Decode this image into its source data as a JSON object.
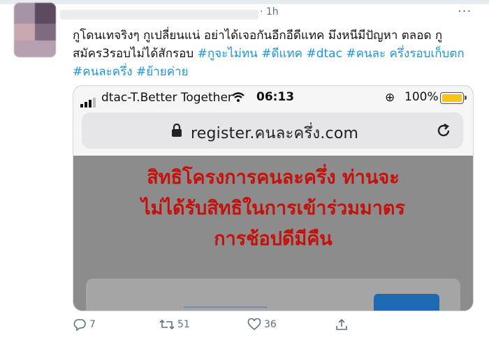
{
  "tweet": {
    "time": "· 1h",
    "more": "···",
    "text_plain_1": "กูโดนเทจริงๆ กูเปลี่ยนแน่ อย่าได้เจอกันอีกอีดีแทค มึงหนีมีปัญหา ตลอด กูสมัคร3รอบไม่ได้สักรอบ ",
    "hashtag_1": "#กูจะไม่ทน",
    "hashtag_2": "#ดีแทค",
    "hashtag_3": "#dtac",
    "hashtag_4": "#คนละ ครึ่งรอบเก็บตก",
    "hashtag_5": "#คนละครึ่ง",
    "hashtag_6": "#ย้ายค่าย"
  },
  "screenshot": {
    "carrier": "dtac-T.Better Together",
    "clock": "06:13",
    "battery_pct": "100%",
    "battery_level": 1.0,
    "url": "register.คนละครึ่ง.com",
    "message_line_1": "สิทธิโครงการคนละครึ่ง ท่านจะ",
    "message_line_2": "ไม่ได้รับสิทธิในการเข้าร่วมมาตร",
    "message_line_3": "การช้อปดีมีคืน"
  },
  "actions": {
    "replies": "7",
    "retweets": "51",
    "likes": "36"
  },
  "colors": {
    "hashtag": "#1b95e0",
    "message": "#c4110c",
    "battery": "#f5c518"
  }
}
